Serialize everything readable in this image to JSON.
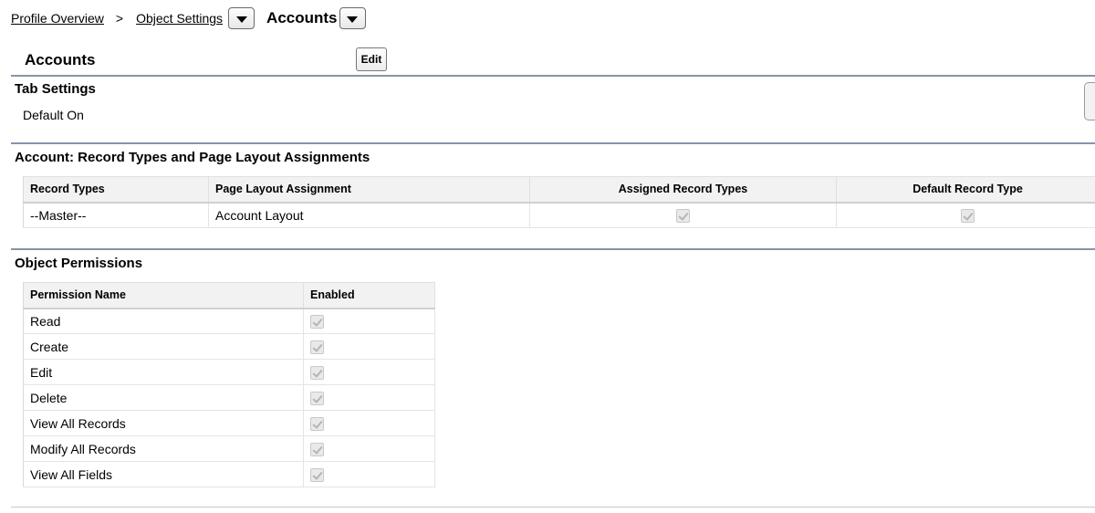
{
  "breadcrumb": {
    "profile_overview": "Profile Overview",
    "separator": ">",
    "object_settings": "Object Settings",
    "current": "Accounts"
  },
  "header": {
    "title": "Accounts",
    "edit_label": "Edit"
  },
  "tab_settings": {
    "title": "Tab Settings",
    "value": "Default On"
  },
  "record_types": {
    "title": "Account: Record Types and Page Layout Assignments",
    "columns": [
      "Record Types",
      "Page Layout Assignment",
      "Assigned Record Types",
      "Default Record Type"
    ],
    "rows": [
      {
        "record_type": "--Master--",
        "page_layout": "Account Layout",
        "assigned": true,
        "default": true
      }
    ]
  },
  "object_permissions": {
    "title": "Object Permissions",
    "columns": [
      "Permission Name",
      "Enabled"
    ],
    "rows": [
      {
        "name": "Read",
        "enabled": true
      },
      {
        "name": "Create",
        "enabled": true
      },
      {
        "name": "Edit",
        "enabled": true
      },
      {
        "name": "Delete",
        "enabled": true
      },
      {
        "name": "View All Records",
        "enabled": true
      },
      {
        "name": "Modify All Records",
        "enabled": true
      },
      {
        "name": "View All Fields",
        "enabled": true
      }
    ]
  },
  "icons": {
    "dropdown": "chevron-down-icon",
    "checkbox": "checkbox-checked-disabled-icon"
  }
}
